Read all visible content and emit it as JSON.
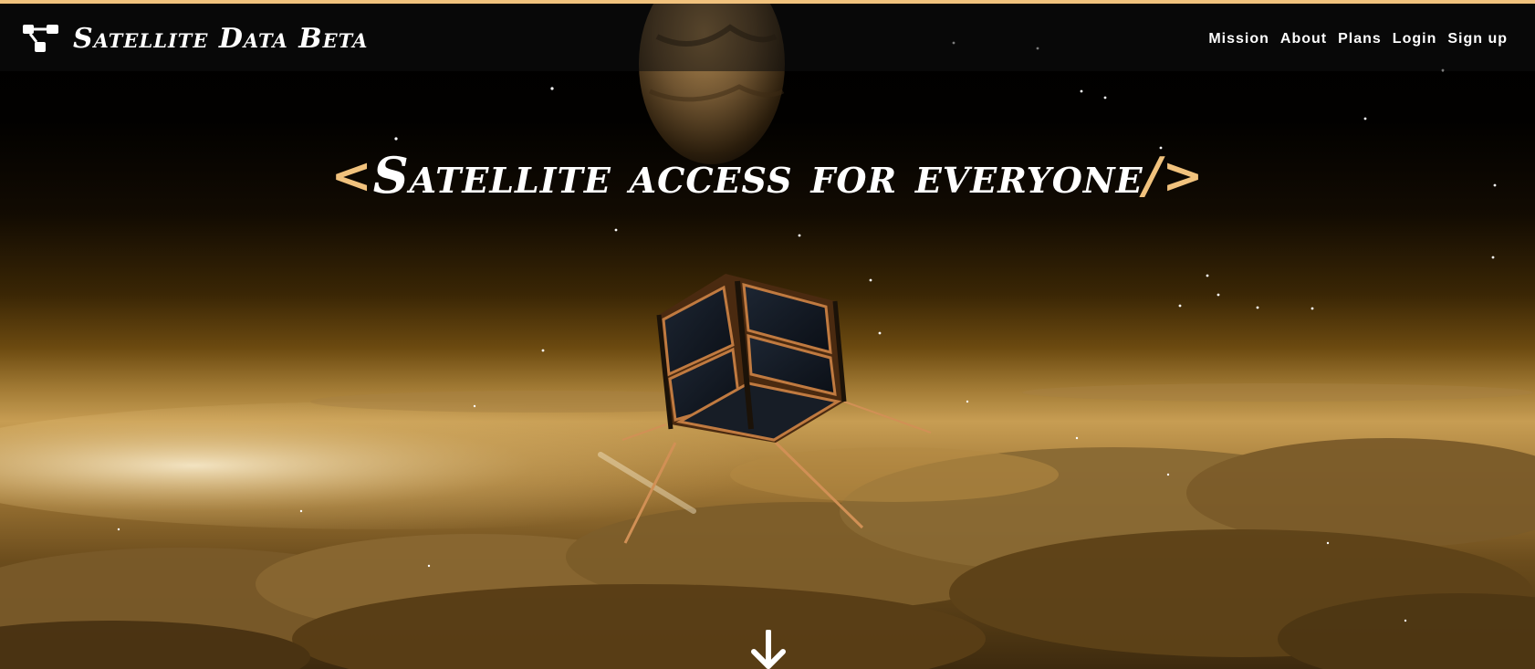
{
  "header": {
    "brand_title": "Satellite Data Beta",
    "logo_icon": "network-nodes-icon"
  },
  "nav": {
    "items": [
      {
        "label": "Mission"
      },
      {
        "label": "About"
      },
      {
        "label": "Plans"
      },
      {
        "label": "Login"
      },
      {
        "label": "Sign up"
      }
    ]
  },
  "hero": {
    "headline_open": "<",
    "headline_text": "Satellite access for everyone",
    "headline_close": "/>",
    "scroll_icon": "arrow-down-icon"
  },
  "colors": {
    "accent": "#f1c27d",
    "text": "#ffffff",
    "background": "#000000"
  }
}
